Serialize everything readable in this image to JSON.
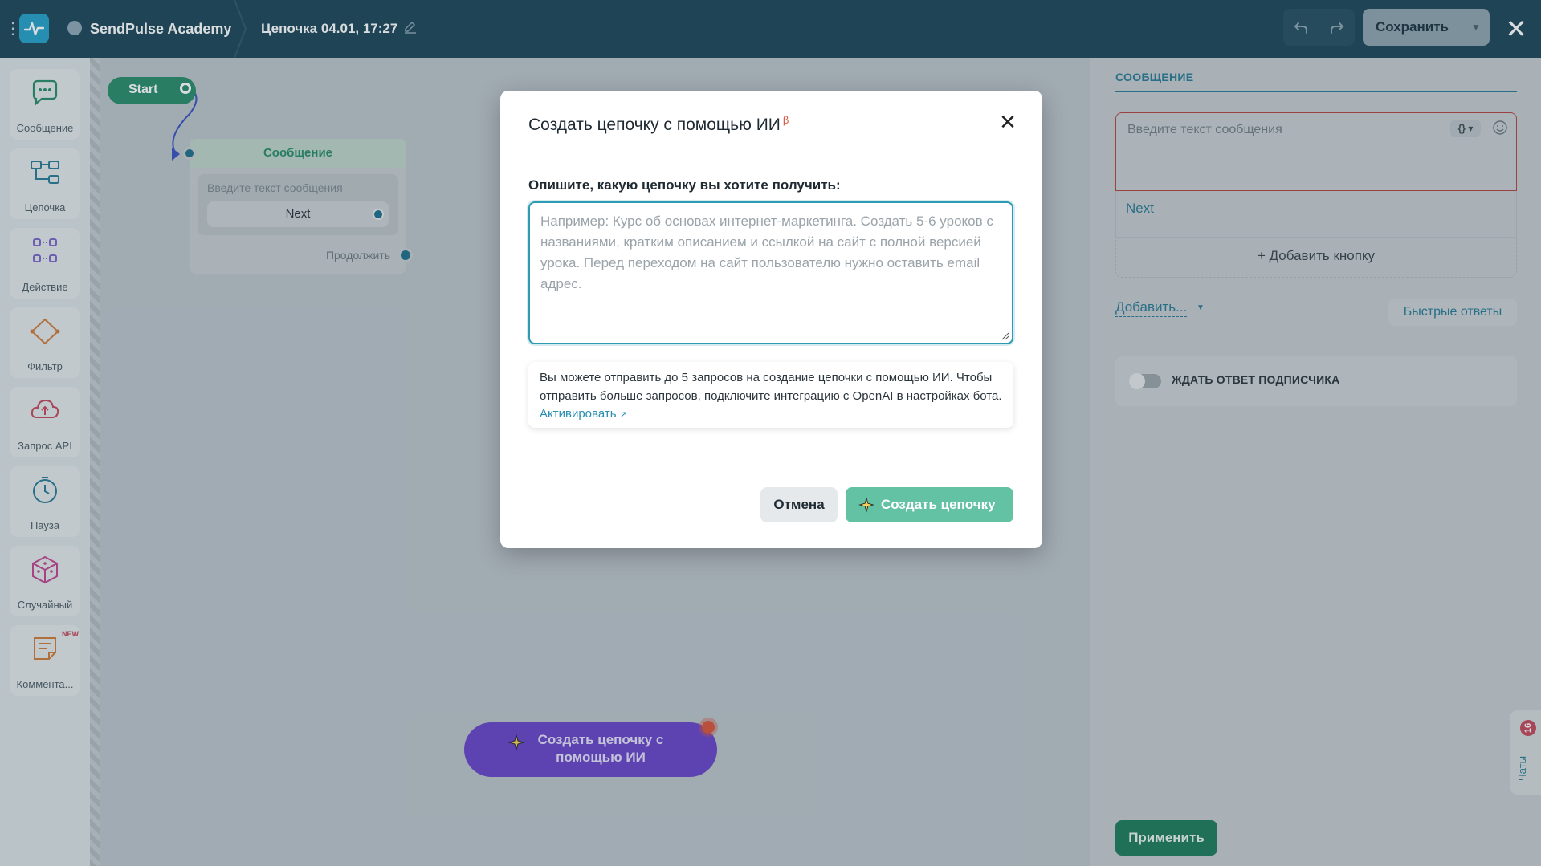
{
  "header": {
    "project_name": "SendPulse Academy",
    "flow_name": "Цепочка 04.01, 17:27",
    "save_label": "Сохранить"
  },
  "tools": [
    {
      "label": "Сообщение",
      "icon": "message-bubble-icon"
    },
    {
      "label": "Цепочка",
      "icon": "chain-icon"
    },
    {
      "label": "Действие",
      "icon": "action-icon"
    },
    {
      "label": "Фильтр",
      "icon": "filter-icon"
    },
    {
      "label": "Запрос API",
      "icon": "cloud-api-icon"
    },
    {
      "label": "Пауза",
      "icon": "clock-icon"
    },
    {
      "label": "Случайный",
      "icon": "dice-icon"
    },
    {
      "label": "Коммента...",
      "icon": "comment-icon",
      "badge": "NEW"
    }
  ],
  "canvas": {
    "start_label": "Start",
    "message_node": {
      "title": "Сообщение",
      "placeholder": "Введите текст сообщения",
      "button_label": "Next",
      "continue_label": "Продолжить"
    },
    "ai_button": "Создать цепочку с помощью ИИ"
  },
  "right_panel": {
    "section_title": "СООБЩЕНИЕ",
    "message_placeholder": "Введите текст сообщения",
    "variables_label": "{}",
    "button_label": "Next",
    "add_button": "+ Добавить кнопку",
    "add_more": "Добавить...",
    "quick_replies": "Быстрые ответы",
    "wait_reply": "ЖДАТЬ ОТВЕТ ПОДПИСЧИКА",
    "apply": "Применить",
    "chats_label": "Чаты",
    "chats_count": "16"
  },
  "modal": {
    "title": "Создать цепочку с помощью ИИ",
    "beta": "β",
    "prompt_label": "Опишите, какую цепочку вы хотите получить:",
    "textarea_placeholder": "Например: Курс об основах интернет-маркетинга. Создать 5-6 уроков с названиями, кратким описанием и ссылкой на сайт с полной версией урока. Перед переходом на сайт пользователю нужно оставить email адрес.",
    "info_text": "Вы можете отправить до 5 запросов на создание цепочки с помощью ИИ. Чтобы отправить больше запросов, подключите интеграцию с OpenAI в настройках бота.",
    "info_link": "Активировать",
    "cancel": "Отмена",
    "create": "Создать цепочку"
  },
  "colors": {
    "topbar": "#1d4658",
    "accent_teal": "#2a7a95",
    "brand_green": "#2a8c6a",
    "ai_purple": "#6a45c9",
    "create_button": "#62c2a3"
  }
}
